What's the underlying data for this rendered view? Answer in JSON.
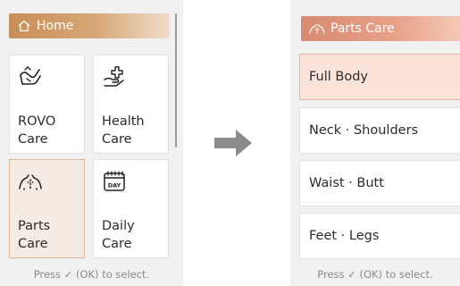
{
  "left_screen": {
    "header": {
      "title": "Home",
      "icon": "home-icon"
    },
    "tiles": [
      {
        "label": "ROVO\nCare",
        "icon": "rovo-hand-icon"
      },
      {
        "label": "Health\nCare",
        "icon": "health-hand-icon"
      },
      {
        "label": "Parts\nCare",
        "icon": "body-parts-icon",
        "selected": true
      },
      {
        "label": "Daily\nCare",
        "icon": "calendar-day-icon",
        "icon_text": "DAY"
      }
    ],
    "footer": "Press ✓ (OK) to select."
  },
  "arrow": {
    "icon": "right-arrow-icon",
    "color": "#8c8c8c"
  },
  "right_screen": {
    "header": {
      "title": "Parts Care",
      "icon": "body-parts-icon"
    },
    "items": [
      {
        "label": "Full Body",
        "selected": true
      },
      {
        "label": "Neck · Shoulders"
      },
      {
        "label": "Waist · Butt"
      },
      {
        "label": "Feet · Legs"
      }
    ],
    "footer": "Press ✓ (OK) to select."
  },
  "colors": {
    "home_header": "#c98e57",
    "parts_header": "#d88a72",
    "selected_tile_bg": "#f3ebe4",
    "selected_row_bg": "#fbe3da"
  }
}
